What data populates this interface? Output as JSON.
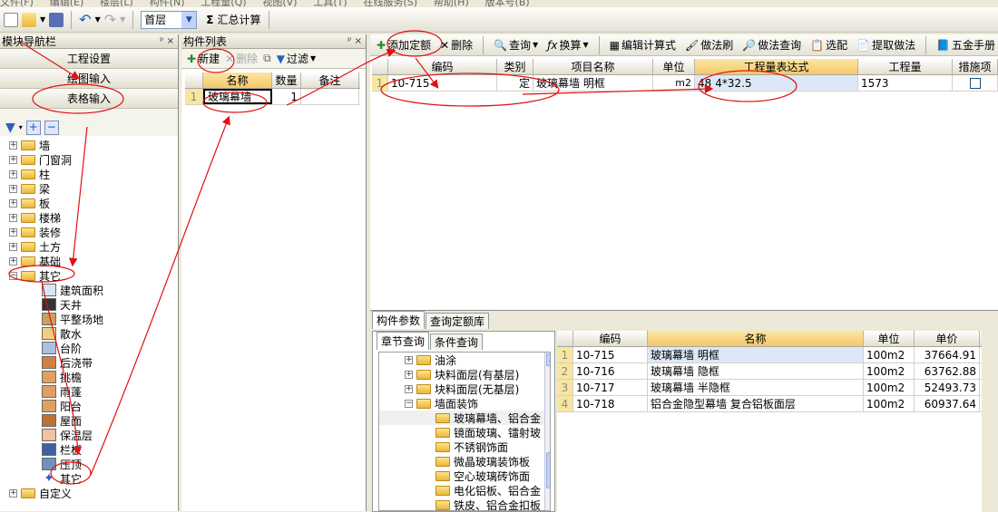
{
  "menubar": {
    "items": [
      "文件(F)",
      "编辑(E)",
      "楼层(L)",
      "构件(N)",
      "工程量(Q)",
      "视图(V)",
      "工具(T)",
      "在线服务(S)",
      "帮助(H)",
      "版本号(B)"
    ]
  },
  "toolbar": {
    "floor_value": "首层",
    "sum_label": "汇总计算",
    "sigma": "Σ"
  },
  "nav": {
    "title": "模块导航栏",
    "pin": "ᵖ ×",
    "buttons": [
      "工程设置",
      "绘图输入",
      "表格输入"
    ],
    "tree": [
      {
        "label": "墙",
        "pm": "+"
      },
      {
        "label": "门窗洞",
        "pm": "+"
      },
      {
        "label": "柱",
        "pm": "+"
      },
      {
        "label": "梁",
        "pm": "+"
      },
      {
        "label": "板",
        "pm": "+"
      },
      {
        "label": "楼梯",
        "pm": "+"
      },
      {
        "label": "装修",
        "pm": "+"
      },
      {
        "label": "土方",
        "pm": "+"
      },
      {
        "label": "基础",
        "pm": "+"
      },
      {
        "label": "其它",
        "pm": "−"
      }
    ],
    "leaves": [
      "建筑面积",
      "天井",
      "平整场地",
      "散水",
      "台阶",
      "后浇带",
      "挑檐",
      "雨蓬",
      "阳台",
      "屋面",
      "保温层",
      "栏板",
      "压顶",
      "其它"
    ],
    "bottom": {
      "label": "自定义",
      "pm": "+"
    }
  },
  "comp": {
    "title": "构件列表",
    "new_label": "新建",
    "delete_label": "删除",
    "filter_label": "过滤",
    "headers": [
      "名称",
      "数量",
      "备注"
    ],
    "row": {
      "num": "1",
      "name": "玻璃幕墙",
      "qty": "1",
      "note": ""
    }
  },
  "main": {
    "tools": [
      "添加定额",
      "删除",
      "查询",
      "换算",
      "编辑计算式",
      "做法刷",
      "做法查询",
      "选配",
      "提取做法",
      "五金手册"
    ],
    "headers": [
      "编码",
      "类别",
      "项目名称",
      "单位",
      "工程量表达式",
      "工程量",
      "措施项"
    ],
    "row": {
      "num": "1",
      "code": "10-715",
      "cat": "定",
      "name": "玻璃幕墙 明框",
      "unit": "m2",
      "expr": "4*32.5",
      "expr_prefix": "48",
      "qty": "1573"
    }
  },
  "lower": {
    "tabs": [
      "构件参数",
      "查询定额库"
    ],
    "subtabs": [
      "章节查询",
      "条件查询"
    ],
    "tree": [
      {
        "label": "油涂",
        "pm": "+",
        "level": 0
      },
      {
        "label": "块料面层(有基层)",
        "pm": "+",
        "level": 0
      },
      {
        "label": "块料面层(无基层)",
        "pm": "+",
        "level": 0
      },
      {
        "label": "墙面装饰",
        "pm": "−",
        "level": 0
      },
      {
        "label": "玻璃幕墙、铝合金",
        "level": 1
      },
      {
        "label": "镜面玻璃、镭射玻",
        "level": 1
      },
      {
        "label": "不锈钢饰面",
        "level": 1
      },
      {
        "label": "微晶玻璃装饰板",
        "level": 1
      },
      {
        "label": "空心玻璃砖饰面",
        "level": 1
      },
      {
        "label": "电化铝板、铝合金",
        "level": 1
      },
      {
        "label": "铁皮、铝合金扣板",
        "level": 1
      }
    ],
    "quota_headers": [
      "编码",
      "名称",
      "单位",
      "单价"
    ],
    "quota_rows": [
      {
        "num": "1",
        "code": "10-715",
        "name": "玻璃幕墙 明框",
        "unit": "100m2",
        "price": "37664.91"
      },
      {
        "num": "2",
        "code": "10-716",
        "name": "玻璃幕墙 隐框",
        "unit": "100m2",
        "price": "63762.88"
      },
      {
        "num": "3",
        "code": "10-717",
        "name": "玻璃幕墙 半隐框",
        "unit": "100m2",
        "price": "52493.73"
      },
      {
        "num": "4",
        "code": "10-718",
        "name": "铝合金隐型幕墙 复合铝板面层",
        "unit": "100m2",
        "price": "60937.64"
      }
    ]
  }
}
